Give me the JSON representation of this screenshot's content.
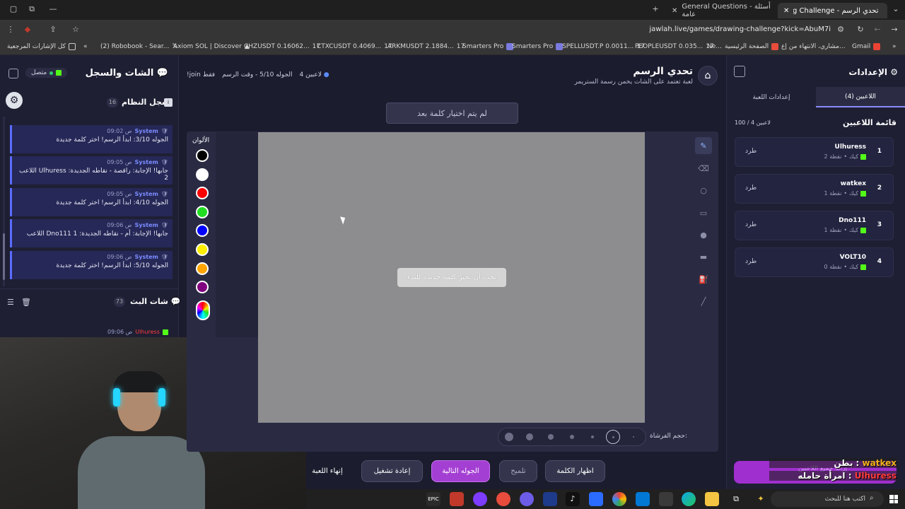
{
  "browser": {
    "tabs": [
      {
        "label": "General Questions - أسئلة عامة",
        "active": false
      },
      {
        "label": "تحدي الرسم - Drawing Challenge",
        "active": true
      }
    ],
    "url": "jawlah.live/games/drawing-challenge?kick=AbuM7i",
    "bookmarks": [
      "كل الإشارات المرجعية",
      "(2) Robobook - Sear...",
      "Axiom SOL | Discover",
      "CHZUSDT 0.16062...",
      "CTXCUSDT 0.4069...",
      "ARKMUSDT 2.1884...",
      "Smarters Pro",
      "Smarters Pro",
      "SPELLUSDT.P 0.0011...",
      "PEOPLEUSDT 0.035...",
      "Ne...",
      "الصفحة الرئيسية",
      "مشاري، الانتهاء من إع...",
      "Gmail"
    ]
  },
  "left_panel": {
    "title": "الشات والسجل",
    "status": "متصل",
    "system_log": {
      "title": "سجل النظام",
      "count": "16",
      "messages": [
        {
          "who": "System",
          "time": "09:02 ص",
          "text": "الجوله 3/10: ابدأ الرسم! اختر كلمة جديدة"
        },
        {
          "who": "System",
          "time": "09:05 ص",
          "text": "اللاعب Ulhuress جابها! الإجابة: راقصة - نقاطه الجديدة: 2"
        },
        {
          "who": "System",
          "time": "09:05 ص",
          "text": "الجوله 4/10: ابدأ الرسم! اختر كلمة جديدة"
        },
        {
          "who": "System",
          "time": "09:06 ص",
          "text": "اللاعب Dno111 جابها! الإجابة: أم - نقاطه الجديدة: 1"
        },
        {
          "who": "System",
          "time": "09:06 ص",
          "text": "الجوله 5/10: ابدأ الرسم! اختر كلمة جديدة"
        }
      ]
    },
    "stream_chat": {
      "title": "شات البث",
      "count": "73",
      "last_user": "Ulhuress",
      "last_time": "09:06 ص"
    }
  },
  "game": {
    "title": "تحدي الرسم",
    "subtitle": "لعبة تعتمد على الشات يخمن رسمة الستريمر",
    "players_online": "4 لاعبين",
    "round": "الجوله 5/10 - وقت الرسم",
    "join_hint": "!join فقط",
    "word_status": "لم يتم اختيار كلمة بعد",
    "canvas_notice": "يجب أن تختر كلمة جديدة للبدء",
    "colors_label": "الألوان",
    "colors": [
      "#000000",
      "#ffffff",
      "#ff0000",
      "#22dd22",
      "#0000ff",
      "#ffee00",
      "#ffa500",
      "#800080"
    ],
    "brush_label": "حجم الفرشاة:",
    "actions": {
      "show_word": "اظهار الكلمة",
      "hint": "تلميح",
      "next_round": "الجوله التالية",
      "restart": "إعادة تشغيل",
      "end_game": "إنهاء اللعبة"
    }
  },
  "right_panel": {
    "title": "الإعدادات",
    "tabs": [
      "اللاعبين (4)",
      "إعدادات اللعبة"
    ],
    "players_title": "قائمة اللاعبين",
    "players_count": "100 / 4 لاعبين",
    "kick_label": "طرد",
    "players": [
      {
        "rank": "1",
        "name": "Ulhuress",
        "platform": "كيك",
        "points": "2 نقطة"
      },
      {
        "rank": "2",
        "name": "watkex",
        "platform": "كيك",
        "points": "1 نقطة"
      },
      {
        "rank": "3",
        "name": "Dno111",
        "platform": "كيك",
        "points": "1 نقطة"
      },
      {
        "rank": "4",
        "name": "VOLT10",
        "platform": "كيك",
        "points": "0 نقطة"
      }
    ],
    "bottom_hint": "إزالة جميع اللاعبين"
  },
  "overlay_chat": [
    {
      "user": "watkex",
      "text": "بطن"
    },
    {
      "user": "Ulhuress",
      "text": "امرأة حامله"
    }
  ],
  "taskbar": {
    "search_placeholder": "اكتب هنا للبحث"
  }
}
